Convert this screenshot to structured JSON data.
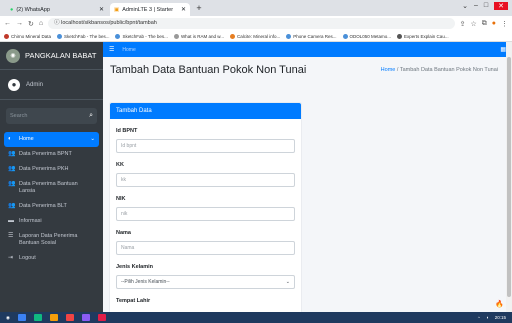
{
  "browser": {
    "tabs": [
      {
        "title": "(2) WhatsApp",
        "active": false
      },
      {
        "title": "AdminLTE 3 | Starter",
        "active": true
      }
    ],
    "url": "localhost/sikbansos/public/bpnt/tambah",
    "bookmarks": [
      "Chirno Mineral Data",
      "SketchFab - The bes...",
      "SketchFab - The bes...",
      "What is RAM and w...",
      "Calcite: Mineral info...",
      "Phone Camera Res...",
      "ODOL050 Metamo...",
      "Experts Explain Cau..."
    ]
  },
  "sidebar": {
    "brand": "PANGKALAN BABAT",
    "user": "Admin",
    "search_placeholder": "Search",
    "items": [
      {
        "label": "Home",
        "icon": "palette-icon",
        "active": true
      },
      {
        "label": "Data Penerima BPNT",
        "icon": "users-icon"
      },
      {
        "label": "Data Penerima PKH",
        "icon": "users-icon"
      },
      {
        "label": "Data Penerima Bantuan Lansia",
        "icon": "users-icon"
      },
      {
        "label": "Data Penerima BLT",
        "icon": "users-icon"
      },
      {
        "label": "Informasi",
        "icon": "folder-icon"
      },
      {
        "label": "Laporan Data Penerima Bantuan Sosial",
        "icon": "list-icon"
      },
      {
        "label": "Logout",
        "icon": "logout-icon"
      }
    ]
  },
  "navbar": {
    "home": "Home"
  },
  "page": {
    "title": "Tambah Data Bantuan Pokok Non Tunai",
    "breadcrumb_home": "Home",
    "breadcrumb_sep": "/",
    "breadcrumb_current": "Tambah Data Bantuan Pokok Non Tunai"
  },
  "form": {
    "header": "Tambah Data",
    "fields": [
      {
        "label": "Id BPNT",
        "placeholder": "Id bpnt"
      },
      {
        "label": "KK",
        "placeholder": "kk"
      },
      {
        "label": "NIK",
        "placeholder": "nik"
      },
      {
        "label": "Nama",
        "placeholder": "Nama"
      }
    ],
    "gender_label": "Jenis Kelamin",
    "gender_selected": "--Pilih Jenis Kelamin--",
    "next_label": "Tempat Lahir"
  },
  "taskbar": {
    "time": "20:15"
  }
}
